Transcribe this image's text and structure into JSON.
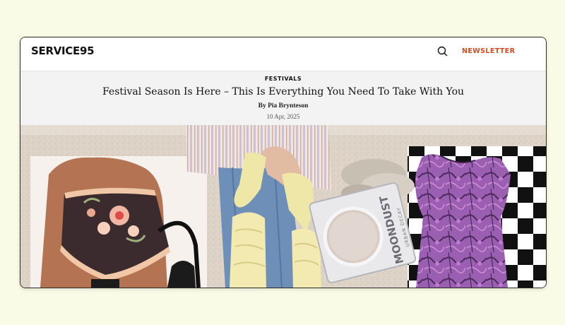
{
  "site": {
    "logo": "SERVICE95",
    "newsletter_label": "NEWSLETTER"
  },
  "article": {
    "category": "FESTIVALS",
    "headline": "Festival Season Is Here – This Is Everything You Need To Take With You",
    "byline": "By Pia Brynteson",
    "date": "10 Apr, 2025"
  },
  "hero": {
    "product_brand": "MOONDUST",
    "product_sub": "URBAN DECAY"
  },
  "icons": {
    "search": "search-icon"
  },
  "colors": {
    "page_background": "#fafbe6",
    "accent": "#d9481c",
    "header_band": "#f3f3f3"
  }
}
